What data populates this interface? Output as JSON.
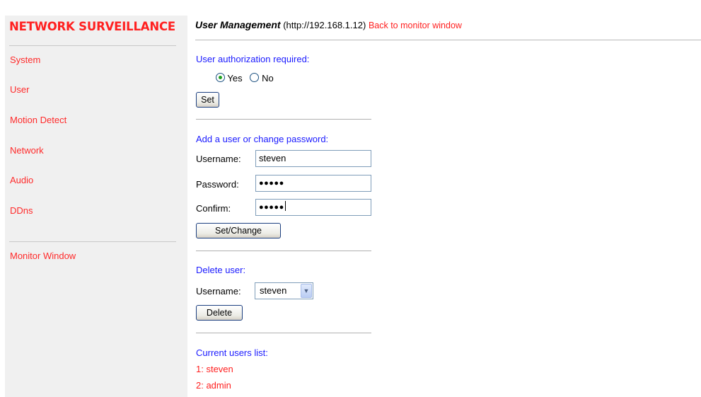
{
  "brand": {
    "title": "NETWORK SURVEILLANCE"
  },
  "sidebar": {
    "items": [
      {
        "label": "System"
      },
      {
        "label": "User"
      },
      {
        "label": "Motion Detect"
      },
      {
        "label": "Network"
      },
      {
        "label": "Audio"
      },
      {
        "label": "DDns"
      }
    ],
    "monitor_link": "Monitor Window"
  },
  "header": {
    "title": "User Management",
    "address": "(http://192.168.1.12)",
    "back_link": "Back to monitor window"
  },
  "auth": {
    "title": "User authorization required:",
    "yes_label": "Yes",
    "no_label": "No",
    "selected": "Yes",
    "set_button": "Set"
  },
  "add_user": {
    "title": "Add a user or change password:",
    "username_label": "Username:",
    "username_value": "steven",
    "password_label": "Password:",
    "password_value": "●●●●●",
    "confirm_label": "Confirm:",
    "confirm_value": "●●●●●",
    "button": "Set/Change"
  },
  "delete_user": {
    "title": "Delete user:",
    "username_label": "Username:",
    "selected_user": "steven",
    "button": "Delete"
  },
  "users_list": {
    "title": "Current users list:",
    "items": [
      "1: steven",
      "2: admin"
    ]
  }
}
